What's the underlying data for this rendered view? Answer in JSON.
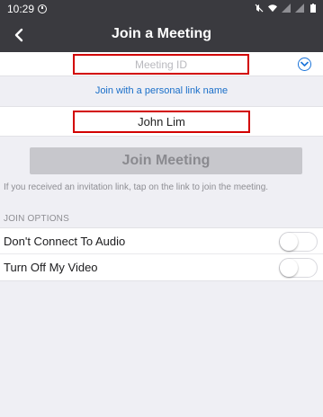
{
  "status_bar": {
    "time": "10:29",
    "icons": [
      "alarm-icon",
      "mute-icon",
      "wifi-icon",
      "signal-icon",
      "signal-icon",
      "battery-icon"
    ]
  },
  "nav": {
    "back_icon": "back-chevron-icon",
    "title": "Join a Meeting"
  },
  "meeting_id": {
    "value": "",
    "placeholder": "Meeting ID",
    "history_icon": "chevron-down-circle-icon"
  },
  "personal_link_label": "Join with a personal link name",
  "name_field": {
    "value": "John Lim",
    "placeholder": ""
  },
  "join_button_label": "Join Meeting",
  "hint_text": "If you received an invitation link, tap on the link to join the meeting.",
  "join_options": {
    "header": "JOIN OPTIONS",
    "items": [
      {
        "label": "Don't Connect To Audio",
        "on": false
      },
      {
        "label": "Turn Off My Video",
        "on": false
      }
    ]
  },
  "colors": {
    "nav_bg": "#3a3a3f",
    "accent": "#1a6fc9",
    "highlight_border": "#d20000",
    "disabled_button": "#c7c7cc",
    "background": "#efeff4"
  }
}
